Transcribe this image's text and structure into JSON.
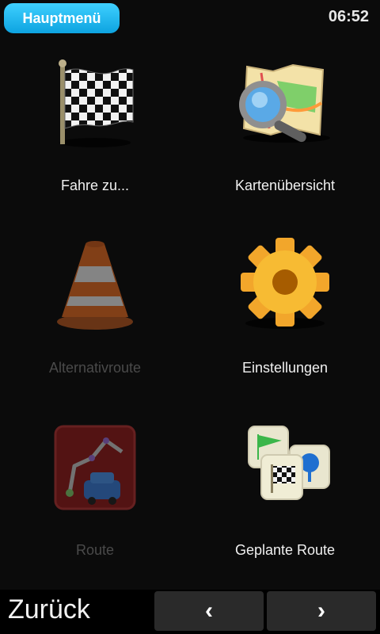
{
  "header": {
    "menu_label": "Hauptmenü",
    "time": "06:52"
  },
  "menu": {
    "items": [
      {
        "label": "Fahre zu...",
        "icon": "checkered-flag-icon",
        "enabled": true
      },
      {
        "label": "Kartenübersicht",
        "icon": "map-magnifier-icon",
        "enabled": true
      },
      {
        "label": "Alternativroute",
        "icon": "traffic-cone-icon",
        "enabled": false
      },
      {
        "label": "Einstellungen",
        "icon": "gear-icon",
        "enabled": true
      },
      {
        "label": "Route",
        "icon": "route-car-icon",
        "enabled": false
      },
      {
        "label": "Geplante Route",
        "icon": "planned-route-icon",
        "enabled": true
      }
    ]
  },
  "footer": {
    "back_label": "Zurück",
    "prev_symbol": "‹",
    "next_symbol": "›"
  },
  "colors": {
    "accent": "#1bb6f0",
    "background": "#0b0b0b",
    "disabled_text": "#4a4a4a"
  }
}
